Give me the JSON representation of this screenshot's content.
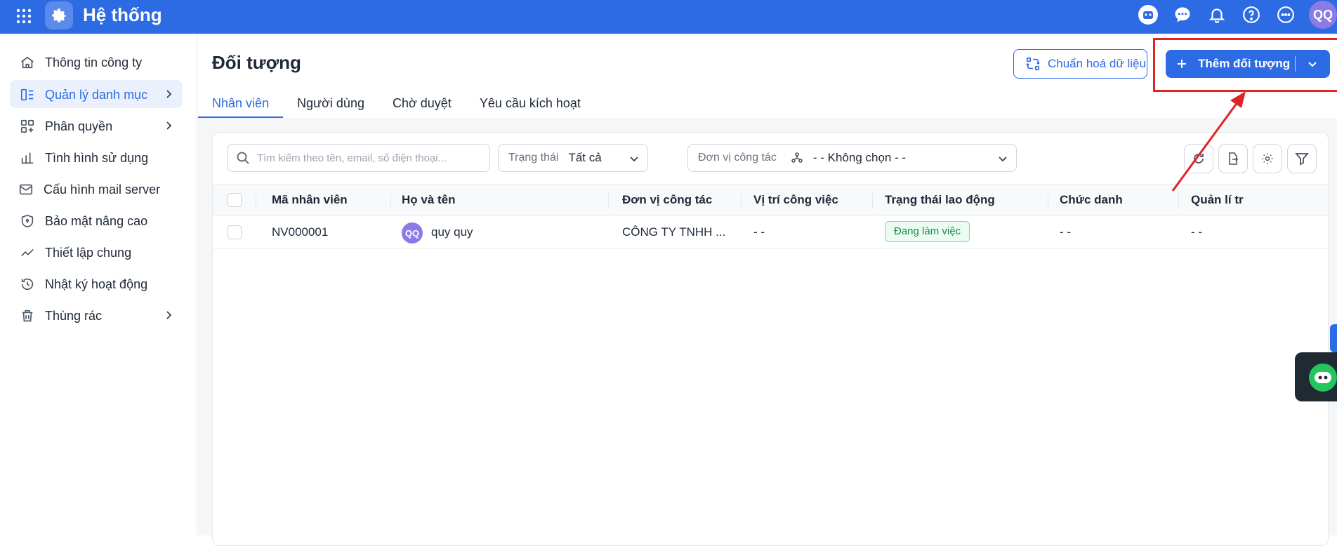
{
  "app": {
    "title": "Hệ thống",
    "user_initials": "QQ"
  },
  "sidebar": {
    "items": [
      {
        "label": "Thông tin công ty"
      },
      {
        "label": "Quản lý danh mục"
      },
      {
        "label": "Phân quyền"
      },
      {
        "label": "Tình hình sử dụng"
      },
      {
        "label": "Cấu hình mail server"
      },
      {
        "label": "Bảo mật nâng cao"
      },
      {
        "label": "Thiết lập chung"
      },
      {
        "label": "Nhật ký hoạt động"
      },
      {
        "label": "Thùng rác"
      }
    ],
    "active_index": 1
  },
  "page": {
    "title": "Đối tượng",
    "tabs": [
      {
        "label": "Nhân viên",
        "active": true
      },
      {
        "label": "Người dùng"
      },
      {
        "label": "Chờ duyệt"
      },
      {
        "label": "Yêu cầu kích hoạt"
      }
    ],
    "normalize_label": "Chuẩn hoá dữ liệu",
    "add_label": "Thêm đối tượng"
  },
  "filters": {
    "search_placeholder": "Tìm kiếm theo tên, email, số điện thoại...",
    "status_label": "Trạng thái",
    "status_value": "Tất cả",
    "unit_label": "Đơn vị công tác",
    "unit_value": "- - Không chọn - -"
  },
  "table": {
    "headers": [
      "Mã nhân viên",
      "Họ và tên",
      "Đơn vị công tác",
      "Vị trí công việc",
      "Trạng thái lao động",
      "Chức danh",
      "Quản lí tr"
    ],
    "rows": [
      {
        "code": "NV000001",
        "avatar": "QQ",
        "name": "quy quy",
        "unit": "CÔNG TY TNHH ...",
        "position": "- -",
        "status": "Đang làm việc",
        "title": "- -",
        "manager": "- -"
      }
    ]
  },
  "colors": {
    "primary": "#2d6be4",
    "highlight": "#e02424",
    "badge_text": "#138a4b",
    "avatar": "#8c7ae6"
  }
}
